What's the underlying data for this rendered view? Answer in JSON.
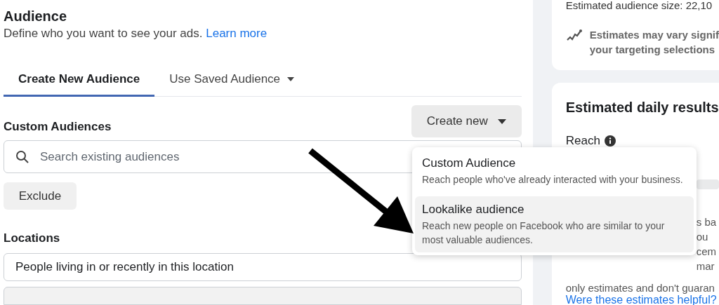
{
  "audience": {
    "title": "Audience",
    "subtitle": "Define who you want to see your ads.",
    "learn_more": "Learn more"
  },
  "tabs": [
    {
      "label": "Create New Audience",
      "selected": true,
      "dropdown": false
    },
    {
      "label": "Use Saved Audience",
      "selected": false,
      "dropdown": true
    }
  ],
  "custom_audiences": {
    "label": "Custom Audiences",
    "create_button": "Create new",
    "search": {
      "placeholder": "Search existing audiences"
    },
    "exclude_button": "Exclude"
  },
  "create_menu": [
    {
      "title": "Custom Audience",
      "description": "Reach people who've already interacted with your business.",
      "selected": false
    },
    {
      "title": "Lookalike audience",
      "description": "Reach new people on Facebook who are similar to your most valuable audiences.",
      "selected": true
    }
  ],
  "locations": {
    "label": "Locations",
    "value": "People living in or recently in this location"
  },
  "audience_size_card": {
    "size": "Estimated audience size: 22,10",
    "note_lines": [
      "Estimates may vary signif",
      "your targeting selections"
    ]
  },
  "daily_results_card": {
    "title": "Estimated daily results",
    "reach_label": "Reach",
    "hidden_text_fragments": [
      "s ba",
      "ou",
      "cem",
      "mar"
    ],
    "last_line": "only estimates and don't guaran",
    "feedback_link": "Were these estimates helpful?"
  }
}
